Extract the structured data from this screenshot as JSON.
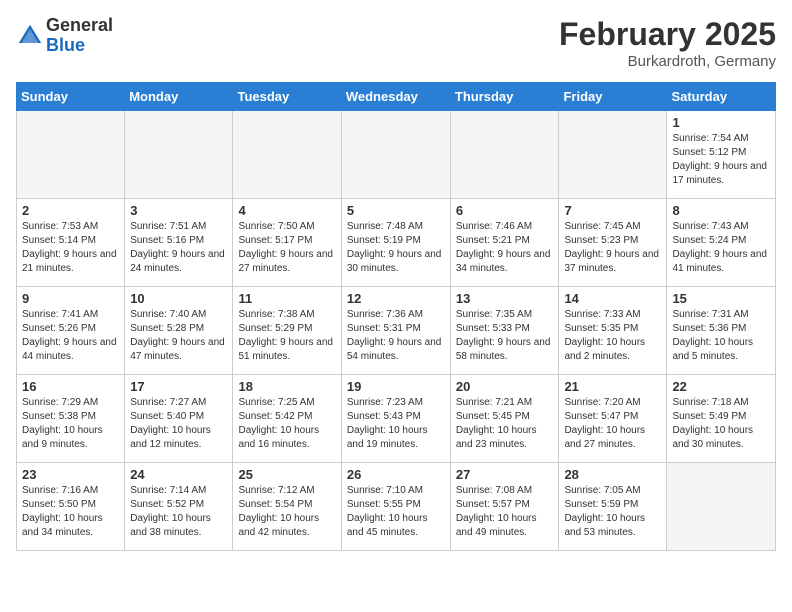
{
  "header": {
    "logo_general": "General",
    "logo_blue": "Blue",
    "month_year": "February 2025",
    "location": "Burkardroth, Germany"
  },
  "days_of_week": [
    "Sunday",
    "Monday",
    "Tuesday",
    "Wednesday",
    "Thursday",
    "Friday",
    "Saturday"
  ],
  "weeks": [
    [
      {
        "day": "",
        "info": ""
      },
      {
        "day": "",
        "info": ""
      },
      {
        "day": "",
        "info": ""
      },
      {
        "day": "",
        "info": ""
      },
      {
        "day": "",
        "info": ""
      },
      {
        "day": "",
        "info": ""
      },
      {
        "day": "1",
        "info": "Sunrise: 7:54 AM\nSunset: 5:12 PM\nDaylight: 9 hours and 17 minutes."
      }
    ],
    [
      {
        "day": "2",
        "info": "Sunrise: 7:53 AM\nSunset: 5:14 PM\nDaylight: 9 hours and 21 minutes."
      },
      {
        "day": "3",
        "info": "Sunrise: 7:51 AM\nSunset: 5:16 PM\nDaylight: 9 hours and 24 minutes."
      },
      {
        "day": "4",
        "info": "Sunrise: 7:50 AM\nSunset: 5:17 PM\nDaylight: 9 hours and 27 minutes."
      },
      {
        "day": "5",
        "info": "Sunrise: 7:48 AM\nSunset: 5:19 PM\nDaylight: 9 hours and 30 minutes."
      },
      {
        "day": "6",
        "info": "Sunrise: 7:46 AM\nSunset: 5:21 PM\nDaylight: 9 hours and 34 minutes."
      },
      {
        "day": "7",
        "info": "Sunrise: 7:45 AM\nSunset: 5:23 PM\nDaylight: 9 hours and 37 minutes."
      },
      {
        "day": "8",
        "info": "Sunrise: 7:43 AM\nSunset: 5:24 PM\nDaylight: 9 hours and 41 minutes."
      }
    ],
    [
      {
        "day": "9",
        "info": "Sunrise: 7:41 AM\nSunset: 5:26 PM\nDaylight: 9 hours and 44 minutes."
      },
      {
        "day": "10",
        "info": "Sunrise: 7:40 AM\nSunset: 5:28 PM\nDaylight: 9 hours and 47 minutes."
      },
      {
        "day": "11",
        "info": "Sunrise: 7:38 AM\nSunset: 5:29 PM\nDaylight: 9 hours and 51 minutes."
      },
      {
        "day": "12",
        "info": "Sunrise: 7:36 AM\nSunset: 5:31 PM\nDaylight: 9 hours and 54 minutes."
      },
      {
        "day": "13",
        "info": "Sunrise: 7:35 AM\nSunset: 5:33 PM\nDaylight: 9 hours and 58 minutes."
      },
      {
        "day": "14",
        "info": "Sunrise: 7:33 AM\nSunset: 5:35 PM\nDaylight: 10 hours and 2 minutes."
      },
      {
        "day": "15",
        "info": "Sunrise: 7:31 AM\nSunset: 5:36 PM\nDaylight: 10 hours and 5 minutes."
      }
    ],
    [
      {
        "day": "16",
        "info": "Sunrise: 7:29 AM\nSunset: 5:38 PM\nDaylight: 10 hours and 9 minutes."
      },
      {
        "day": "17",
        "info": "Sunrise: 7:27 AM\nSunset: 5:40 PM\nDaylight: 10 hours and 12 minutes."
      },
      {
        "day": "18",
        "info": "Sunrise: 7:25 AM\nSunset: 5:42 PM\nDaylight: 10 hours and 16 minutes."
      },
      {
        "day": "19",
        "info": "Sunrise: 7:23 AM\nSunset: 5:43 PM\nDaylight: 10 hours and 19 minutes."
      },
      {
        "day": "20",
        "info": "Sunrise: 7:21 AM\nSunset: 5:45 PM\nDaylight: 10 hours and 23 minutes."
      },
      {
        "day": "21",
        "info": "Sunrise: 7:20 AM\nSunset: 5:47 PM\nDaylight: 10 hours and 27 minutes."
      },
      {
        "day": "22",
        "info": "Sunrise: 7:18 AM\nSunset: 5:49 PM\nDaylight: 10 hours and 30 minutes."
      }
    ],
    [
      {
        "day": "23",
        "info": "Sunrise: 7:16 AM\nSunset: 5:50 PM\nDaylight: 10 hours and 34 minutes."
      },
      {
        "day": "24",
        "info": "Sunrise: 7:14 AM\nSunset: 5:52 PM\nDaylight: 10 hours and 38 minutes."
      },
      {
        "day": "25",
        "info": "Sunrise: 7:12 AM\nSunset: 5:54 PM\nDaylight: 10 hours and 42 minutes."
      },
      {
        "day": "26",
        "info": "Sunrise: 7:10 AM\nSunset: 5:55 PM\nDaylight: 10 hours and 45 minutes."
      },
      {
        "day": "27",
        "info": "Sunrise: 7:08 AM\nSunset: 5:57 PM\nDaylight: 10 hours and 49 minutes."
      },
      {
        "day": "28",
        "info": "Sunrise: 7:05 AM\nSunset: 5:59 PM\nDaylight: 10 hours and 53 minutes."
      },
      {
        "day": "",
        "info": ""
      }
    ]
  ]
}
